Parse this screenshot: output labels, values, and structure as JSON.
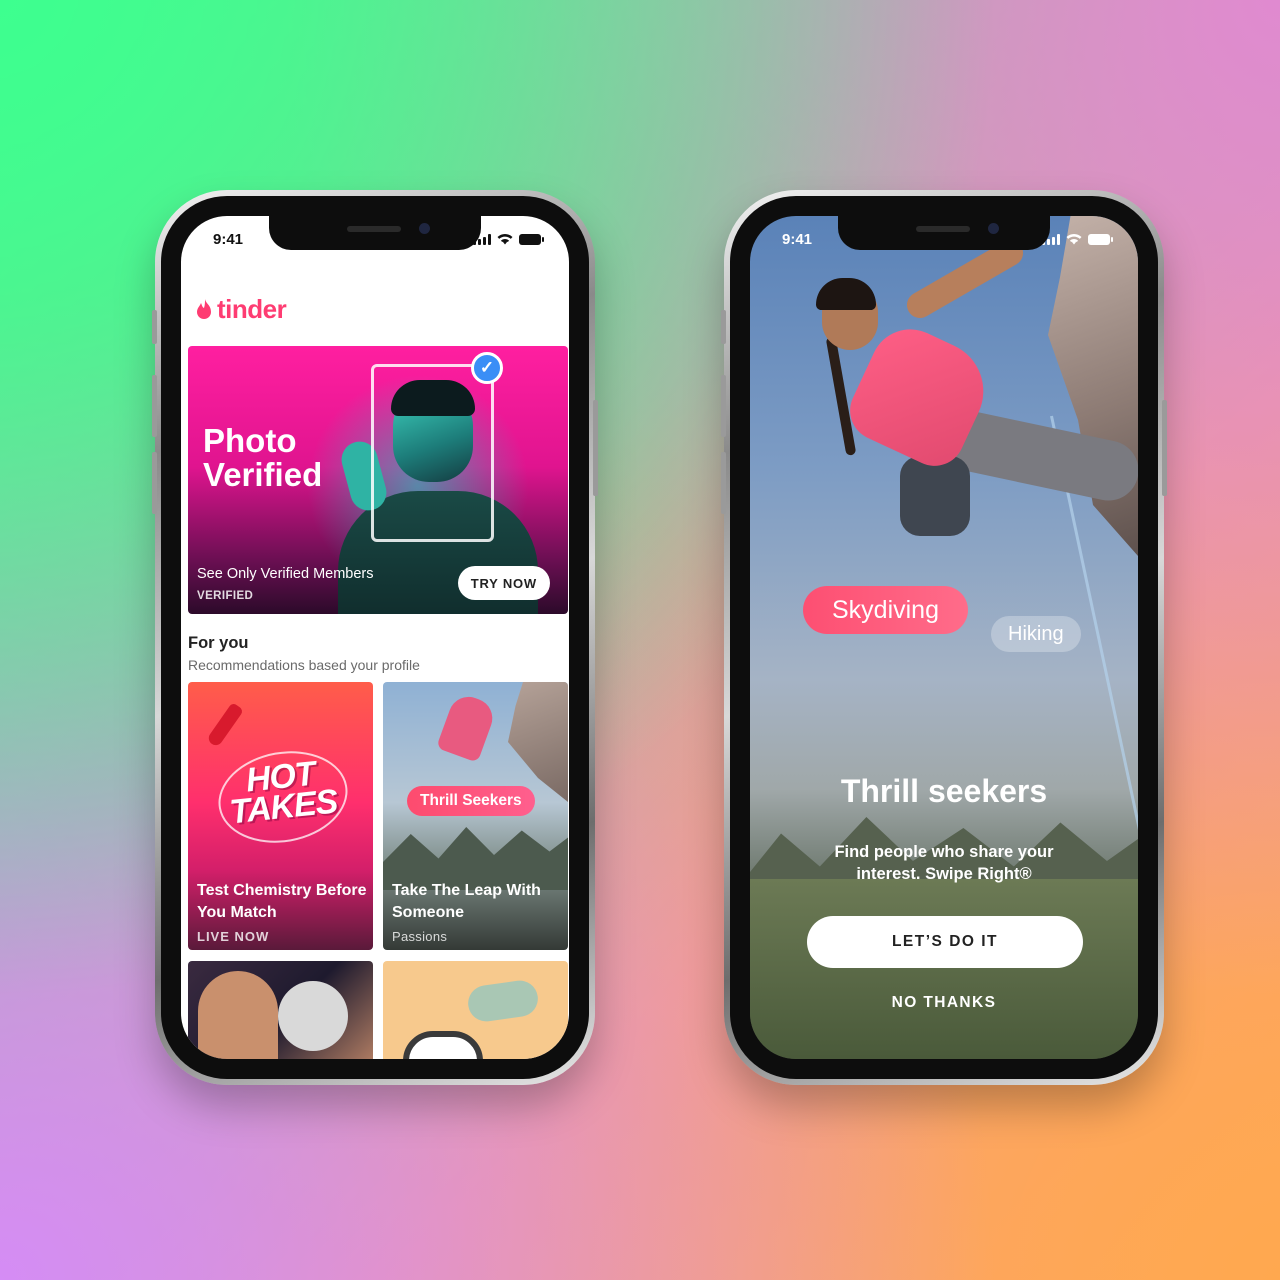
{
  "left_phone": {
    "status_time": "9:41",
    "logo_text": "tinder",
    "banner": {
      "title_line1": "Photo",
      "title_line2": "Verified",
      "subtitle": "See Only Verified Members",
      "tag": "VERIFIED",
      "button_label": "TRY NOW"
    },
    "section": {
      "title": "For you",
      "subtitle": "Recommendations based your profile"
    },
    "cards": [
      {
        "art_line1": "HOT",
        "art_line2": "TAKES",
        "title": "Test Chemistry Before You Match",
        "meta": "LIVE NOW"
      },
      {
        "chip": "Thrill Seekers",
        "title": "Take The Leap With Someone",
        "meta": "Passions"
      }
    ]
  },
  "right_phone": {
    "status_time": "9:41",
    "chips": {
      "primary": "Skydiving",
      "secondary": "Hiking"
    },
    "title": "Thrill seekers",
    "description": "Find people who share your interest. Swipe Right®",
    "primary_button": "LET’S DO IT",
    "secondary_button": "NO THANKS"
  },
  "colors": {
    "brand": "#fe3c72",
    "verified_blue": "#3a8ef6"
  },
  "icons": [
    "flame-icon",
    "checkmark-icon",
    "signal-icon",
    "wifi-icon",
    "battery-icon"
  ]
}
